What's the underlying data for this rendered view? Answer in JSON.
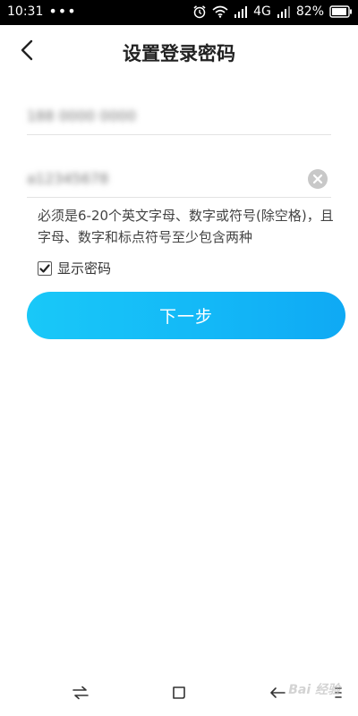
{
  "status_bar": {
    "time": "10:31",
    "dots": "•••",
    "network": "4G",
    "battery": "82%"
  },
  "header": {
    "title": "设置登录密码"
  },
  "form": {
    "account_value": "188 0000 0000",
    "password_value": "a12345678",
    "hint": "必须是6-20个英文字母、数字或符号(除空格)，且字母、数字和标点符号至少包含两种",
    "show_password_label": "显示密码",
    "show_password_checked": true,
    "next_label": "下一步"
  },
  "colors": {
    "primary_button": "#13b7f7",
    "text": "#333333",
    "divider": "#e3e3e3"
  },
  "watermark": "Bai 经验"
}
